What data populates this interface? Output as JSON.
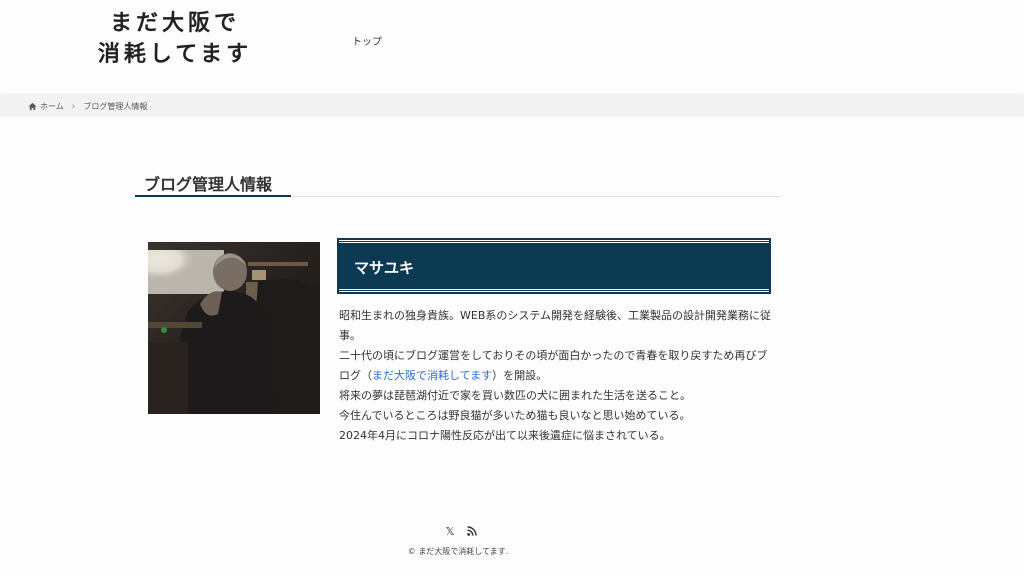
{
  "header": {
    "logo_line1": "まだ大阪で",
    "logo_line2": "消耗してます",
    "nav": [
      {
        "label": "トップ"
      }
    ]
  },
  "breadcrumb": {
    "home": "ホーム",
    "current": "ブログ管理人情報"
  },
  "page": {
    "title": "ブログ管理人情報"
  },
  "profile": {
    "name": "マサユキ",
    "bio_line1": "昭和生まれの独身貴族。WEB系のシステム開発を経験後、工業製品の設計開発業務に従事。",
    "bio_line2_pre": "二十代の頃にブログ運営をしておりその頃が面白かったので青春を取り戻すため再びブログ（",
    "bio_link": "まだ大阪で消耗してます",
    "bio_line2_post": "）を開設。",
    "bio_line3": "将来の夢は琵琶湖付近で家を買い数匹の犬に囲まれた生活を送ること。",
    "bio_line4": "今住んでいるところは野良猫が多いため猫も良いなと思い始めている。",
    "bio_line5": "2024年4月にコロナ陽性反応が出て以来後遺症に悩まされている。"
  },
  "footer": {
    "icons": [
      "x-icon",
      "rss-icon"
    ],
    "x_glyph": "𝕏",
    "copyright": "© まだ大阪で消耗してます."
  }
}
